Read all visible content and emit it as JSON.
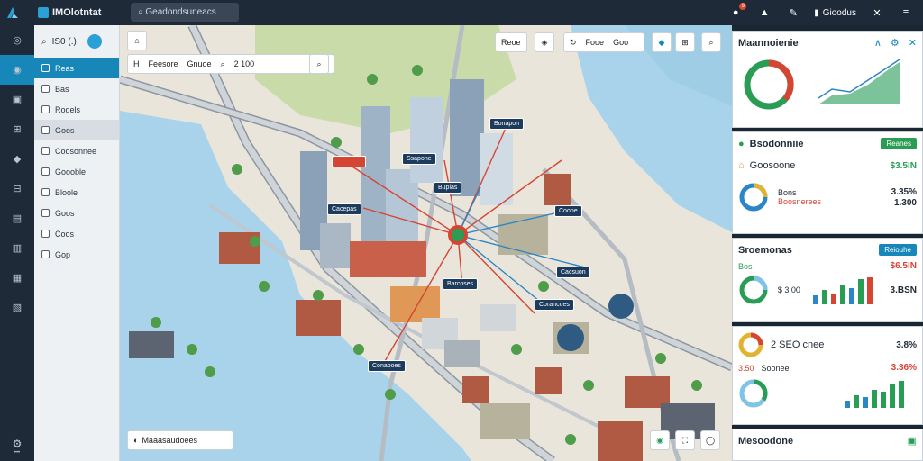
{
  "header": {
    "app_title": "IMOlotntat",
    "search_text": "Geadondsuneacs",
    "user_label": "Gioodus",
    "notif_count": "9"
  },
  "sidebar": {
    "header_label": "IS0 (.)",
    "items": [
      {
        "label": "Reas"
      },
      {
        "label": "Bas"
      },
      {
        "label": "Rodels"
      },
      {
        "label": "Goos"
      },
      {
        "label": "Coosonnee"
      },
      {
        "label": "Goooble"
      },
      {
        "label": "Bloole"
      },
      {
        "label": "Goos"
      },
      {
        "label": "Coos"
      },
      {
        "label": "Gop"
      }
    ]
  },
  "map": {
    "toolbar_left": [
      "H",
      "Feesore",
      "Gnuoe",
      "2 100"
    ],
    "toolbar_right": [
      "Reoe",
      "",
      "Fooe",
      "Goo"
    ],
    "pins": [
      "Bonapon",
      "Caniteso",
      "Ssapone",
      "Buplas",
      "Cacepas",
      "Coone",
      "Cacsuon",
      "Barcoses",
      "Corancues",
      "Conaboes"
    ],
    "bottom_label": "Maaasaudoees"
  },
  "right": {
    "title": "Maannoienie",
    "p2_title": "Bsodonniie",
    "p2_pill": "Reanes",
    "p2_row1_label": "Goosoone",
    "p2_row1_value": "$3.5IN",
    "p2_row2_label": "Bons",
    "p2_row2_value": "3.35%",
    "p2_row3_label": "Boosnerees",
    "p2_row3_value": "1.300",
    "p3_title": "Sroemonas",
    "p3_pill": "Reiouhe",
    "p3_row1_value": "$6.5IN",
    "p3_row1_b": "Bos",
    "p3_row2_value": "3.BSN",
    "p3_row2_b": "$ 3.00",
    "p4_row1_label": "2 SEO cnee",
    "p4_row1_value": "3.8%",
    "p4_row2_value": "3.50",
    "p4_row2_label": "Soonee",
    "p4_row2_b": "3.36%",
    "p5_title": "Mesoodone"
  },
  "colors": {
    "accent": "#1687b8",
    "green": "#2a9d55",
    "red": "#d54534",
    "water": "#a8d3ea",
    "land": "#e9e5da"
  }
}
